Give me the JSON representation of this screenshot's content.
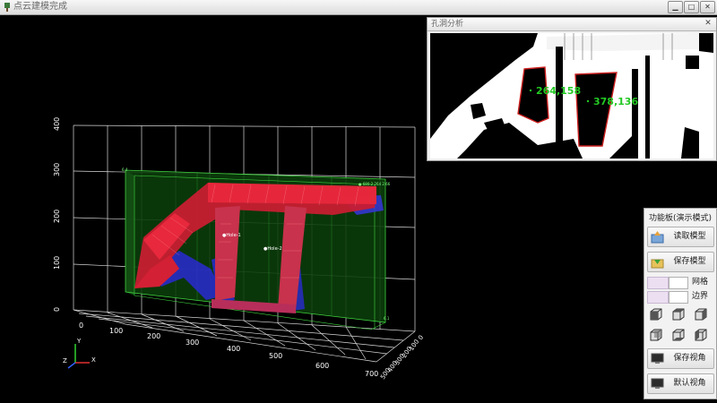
{
  "window": {
    "title": "点云建模完成",
    "min_label": "▁",
    "max_label": "□",
    "close_label": "✕"
  },
  "plot": {
    "y_ticks": [
      "0",
      "100",
      "200",
      "300",
      "400"
    ],
    "x_ticks": [
      "0",
      "100",
      "200",
      "300",
      "400",
      "500",
      "600",
      "700"
    ],
    "z_ticks": [
      "0",
      "100",
      "200",
      "300",
      "400",
      "500"
    ],
    "hole_labels": [
      "●Hole-1",
      "●Hole-2"
    ],
    "corner_label_top": "6.4",
    "corner_label_coords": "● 680.2 264 2.66",
    "corner_label_bottom": "6.1",
    "axis_letters": {
      "x": "X",
      "y": "Y",
      "z": "Z"
    },
    "colors": {
      "box_fill": "#0b3d0b",
      "box_edge": "#3fd23f",
      "cloud_red": "#e8283c",
      "cloud_blue": "#2a2ad2",
      "grid": "#ffffff"
    }
  },
  "analysis": {
    "title": "孔洞分析",
    "close_label": "✕",
    "coord_1": "264,158",
    "coord_2": "378,136",
    "label_color": "#23c823"
  },
  "panel": {
    "title": "功能板(演示模式)",
    "load_label": "读取模型",
    "save_label": "保存模型",
    "grid_label": "网格",
    "border_label": "边界",
    "save_view_label": "保存视角",
    "default_view_label": "默认视角"
  }
}
